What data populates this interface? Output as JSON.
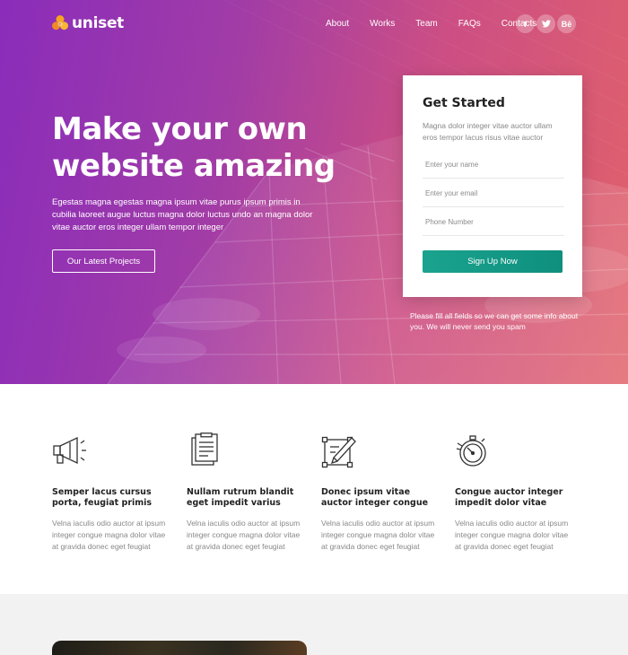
{
  "brand": {
    "name": "uniset"
  },
  "nav": {
    "items": [
      {
        "label": "About"
      },
      {
        "label": "Works"
      },
      {
        "label": "Team"
      },
      {
        "label": "FAQs"
      },
      {
        "label": "Contacts"
      }
    ],
    "socials": [
      {
        "icon": "facebook-icon",
        "glyph": "f"
      },
      {
        "icon": "twitter-icon",
        "glyph": "t"
      },
      {
        "icon": "behance-icon",
        "glyph": "Bē"
      }
    ]
  },
  "hero": {
    "title": "Make your own website amazing",
    "description": "Egestas magna egestas magna ipsum vitae purus ipsum primis in cubilia laoreet augue luctus magna dolor luctus undo an magna dolor vitae auctor eros integer ullam tempor integer",
    "button": "Our Latest Projects",
    "note": "Please fill all fields so we can get some info about you. We will never send you spam"
  },
  "signup": {
    "title": "Get Started",
    "description": "Magna dolor integer vitae auctor ullam eros tempor lacus risus vitae auctor",
    "fields": [
      {
        "placeholder": "Enter your name"
      },
      {
        "placeholder": "Enter your email"
      },
      {
        "placeholder": "Phone Number"
      }
    ],
    "submit": "Sign Up Now",
    "accent": "#14998a"
  },
  "features": [
    {
      "icon": "megaphone-icon",
      "title": "Semper lacus cursus porta, feugiat primis",
      "text": "Velna iaculis odio auctor at ipsum integer congue magna dolor vitae at gravida donec eget feugiat"
    },
    {
      "icon": "clipboard-icon",
      "title": "Nullam rutrum blandit eget impedit varius",
      "text": "Velna iaculis odio auctor at ipsum integer congue magna dolor vitae at gravida donec eget feugiat"
    },
    {
      "icon": "design-pencil-icon",
      "title": "Donec ipsum vitae auctor integer congue",
      "text": "Velna iaculis odio auctor at ipsum integer congue magna dolor vitae at gravida donec eget feugiat"
    },
    {
      "icon": "stopwatch-icon",
      "title": "Congue auctor integer impedit dolor vitae",
      "text": "Velna iaculis odio auctor at ipsum integer congue magna dolor vitae at gravida donec eget feugiat"
    }
  ],
  "colors": {
    "hero_start": "#8a2fb8",
    "hero_end": "#e0606c",
    "logo": "#f5a623"
  }
}
